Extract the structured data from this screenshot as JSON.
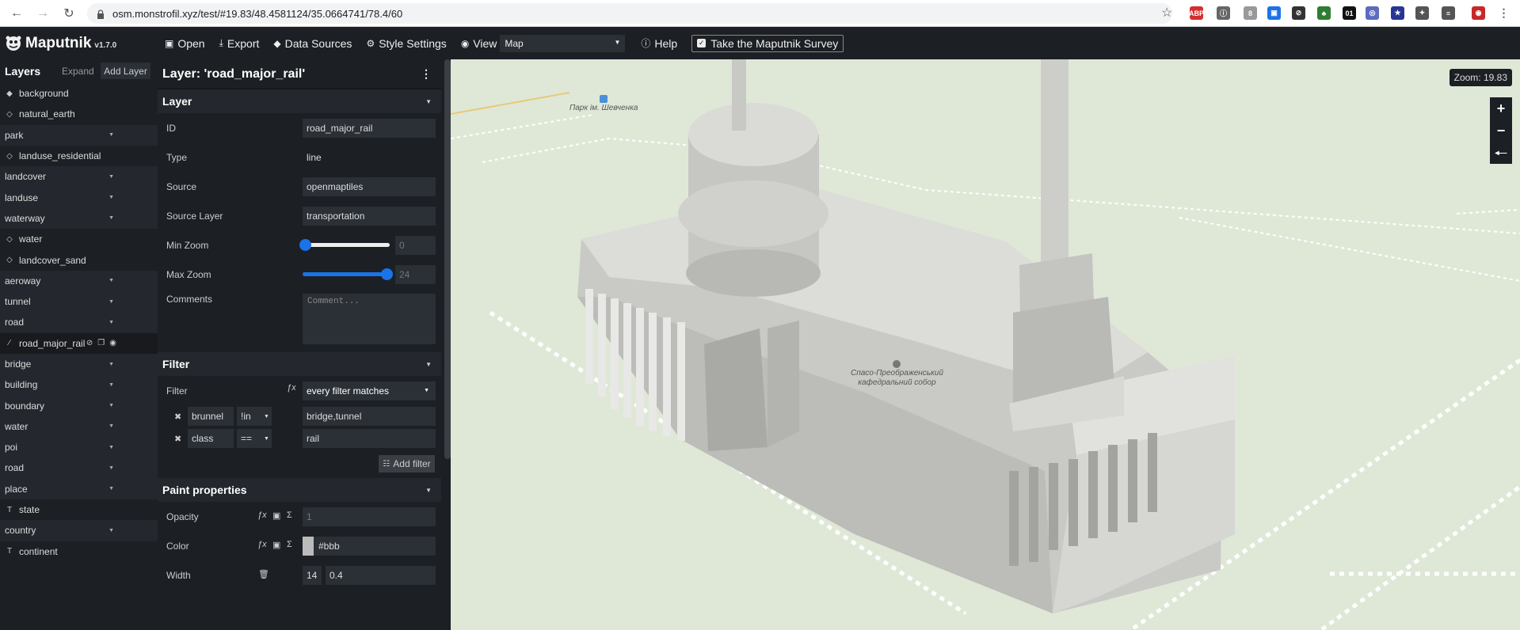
{
  "browser": {
    "url": "osm.monstrofil.xyz/test/#19.83/48.4581124/35.0664741/78.4/60",
    "extensions": [
      {
        "name": "abp",
        "label": "ABP",
        "color": "#d32f2f"
      },
      {
        "name": "ext2",
        "label": "ⓘ",
        "color": "#666"
      },
      {
        "name": "ext3",
        "label": "8",
        "color": "#999"
      },
      {
        "name": "ext4",
        "label": "▣",
        "color": "#1a73e8"
      },
      {
        "name": "ext5",
        "label": "⊘",
        "color": "#333"
      },
      {
        "name": "ext6",
        "label": "♣",
        "color": "#2e7d32"
      },
      {
        "name": "ext7",
        "label": "01",
        "color": "#111"
      },
      {
        "name": "ext8",
        "label": "◎",
        "color": "#5c6bc0"
      },
      {
        "name": "ext9",
        "label": "★",
        "color": "#283593"
      },
      {
        "name": "ext10",
        "label": "✦",
        "color": "#555"
      },
      {
        "name": "ext11",
        "label": "≡",
        "color": "#555"
      },
      {
        "name": "ext12",
        "label": "◉",
        "color": "#c62828"
      }
    ]
  },
  "app": {
    "name": "Maputnik",
    "version": "v1.7.0",
    "menu": {
      "open": "Open",
      "export": "Export",
      "data_sources": "Data Sources",
      "style_settings": "Style Settings",
      "view": "View",
      "view_value": "Map",
      "help": "Help",
      "survey": "Take the Maputnik Survey"
    }
  },
  "layers_panel": {
    "title": "Layers",
    "expand": "Expand",
    "add_layer": "Add Layer",
    "items": [
      {
        "label": "background",
        "icon": "fill",
        "group": false
      },
      {
        "label": "natural_earth",
        "icon": "raster",
        "group": false
      },
      {
        "label": "park",
        "icon": "",
        "group": true
      },
      {
        "label": "landuse_residential",
        "icon": "raster",
        "group": false
      },
      {
        "label": "landcover",
        "icon": "",
        "group": true
      },
      {
        "label": "landuse",
        "icon": "",
        "group": true
      },
      {
        "label": "waterway",
        "icon": "",
        "group": true
      },
      {
        "label": "water",
        "icon": "raster",
        "group": false
      },
      {
        "label": "landcover_sand",
        "icon": "raster",
        "group": false
      },
      {
        "label": "aeroway",
        "icon": "",
        "group": true
      },
      {
        "label": "tunnel",
        "icon": "",
        "group": true
      },
      {
        "label": "road",
        "icon": "",
        "group": true
      },
      {
        "label": "road_major_rail",
        "icon": "line",
        "group": false,
        "active": true
      },
      {
        "label": "bridge",
        "icon": "",
        "group": true
      },
      {
        "label": "building",
        "icon": "",
        "group": true
      },
      {
        "label": "boundary",
        "icon": "",
        "group": true
      },
      {
        "label": "water",
        "icon": "",
        "group": true
      },
      {
        "label": "poi",
        "icon": "",
        "group": true
      },
      {
        "label": "road",
        "icon": "",
        "group": true
      },
      {
        "label": "place",
        "icon": "",
        "group": true
      },
      {
        "label": "state",
        "icon": "text",
        "group": false
      },
      {
        "label": "country",
        "icon": "",
        "group": true
      },
      {
        "label": "continent",
        "icon": "text",
        "group": false
      }
    ]
  },
  "editor": {
    "title": "Layer: 'road_major_rail'",
    "layer_section": "Layer",
    "id_label": "ID",
    "id_value": "road_major_rail",
    "type_label": "Type",
    "type_value": "line",
    "source_label": "Source",
    "source_value": "openmaptiles",
    "source_layer_label": "Source Layer",
    "source_layer_value": "transportation",
    "min_zoom_label": "Min Zoom",
    "min_zoom_value": "0",
    "max_zoom_label": "Max Zoom",
    "max_zoom_value": "24",
    "comments_label": "Comments",
    "comments_placeholder": "Comment...",
    "filter_section": "Filter",
    "filter_label": "Filter",
    "filter_mode": "every filter matches",
    "filters": [
      {
        "key": "brunnel",
        "op": "!in",
        "value": "bridge,tunnel"
      },
      {
        "key": "class",
        "op": "==",
        "value": "rail"
      }
    ],
    "add_filter": "Add filter",
    "paint_section": "Paint properties",
    "opacity_label": "Opacity",
    "opacity_value": "1",
    "color_label": "Color",
    "color_value": "#bbb",
    "width_label": "Width",
    "width_stop_zoom": "14",
    "width_stop_value": "0.4"
  },
  "map": {
    "zoom_label": "Zoom: 19.83",
    "park_label": "Парк ім. Шевченка",
    "cathedral_label_line1": "Спасо-Преображенський",
    "cathedral_label_line2": "кафедральний собор",
    "zoom_in": "+",
    "zoom_out": "−",
    "compass": "◂—"
  },
  "colors": {
    "ui_bg": "#1c1f24",
    "accent": "#1a73e8",
    "map_bg": "#dfe8d7"
  }
}
